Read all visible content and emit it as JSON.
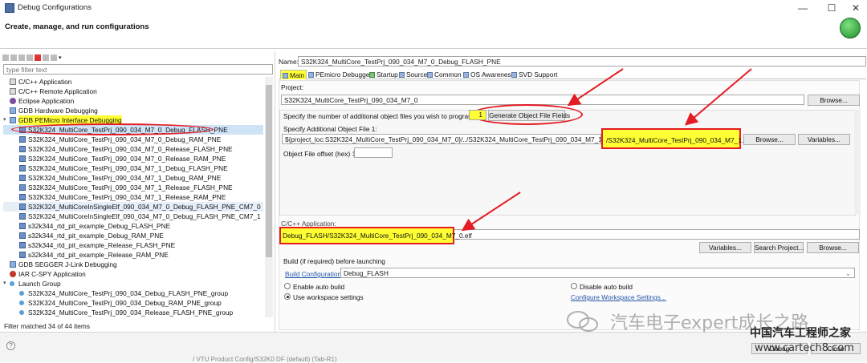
{
  "window": {
    "title": "Debug Configurations",
    "header": "Create, manage, and run configurations",
    "controls": [
      "—",
      "☐",
      "✕"
    ]
  },
  "left": {
    "filter_placeholder": "type filter text",
    "status": "Filter matched 34 of 44 items",
    "items": [
      {
        "label": "C/C++ Application",
        "level": 0,
        "icon": "c-app-icon"
      },
      {
        "label": "C/C++ Remote Application",
        "level": 0,
        "icon": "c-remote-icon"
      },
      {
        "label": "Eclipse Application",
        "level": 0,
        "icon": "eclipse-icon"
      },
      {
        "label": "GDB Hardware Debugging",
        "level": 0,
        "icon": "gdb-icon"
      },
      {
        "label": "GDB PEMicro Interface Debugging",
        "level": 0,
        "icon": "gdb-icon",
        "expanded": true,
        "highlight": true
      },
      {
        "label": "S32K324_MultiCore_TestPrj_090_034_M7_0_Debug_FLASH_PNE",
        "level": 1,
        "icon": "launch-icon",
        "selected": true
      },
      {
        "label": "S32K324_MultiCore_TestPrj_090_034_M7_0_Debug_RAM_PNE",
        "level": 1,
        "icon": "launch-icon"
      },
      {
        "label": "S32K324_MultiCore_TestPrj_090_034_M7_0_Release_FLASH_PNE",
        "level": 1,
        "icon": "launch-icon"
      },
      {
        "label": "S32K324_MultiCore_TestPrj_090_034_M7_0_Release_RAM_PNE",
        "level": 1,
        "icon": "launch-icon"
      },
      {
        "label": "S32K324_MultiCore_TestPrj_090_034_M7_1_Debug_FLASH_PNE",
        "level": 1,
        "icon": "launch-icon"
      },
      {
        "label": "S32K324_MultiCore_TestPrj_090_034_M7_1_Debug_RAM_PNE",
        "level": 1,
        "icon": "launch-icon"
      },
      {
        "label": "S32K324_MultiCore_TestPrj_090_034_M7_1_Release_FLASH_PNE",
        "level": 1,
        "icon": "launch-icon"
      },
      {
        "label": "S32K324_MultiCore_TestPrj_090_034_M7_1_Release_RAM_PNE",
        "level": 1,
        "icon": "launch-icon"
      },
      {
        "label": "S32K324_MultiCoreInSingleElf_090_034_M7_0_Debug_FLASH_PNE_CM7_0",
        "level": 1,
        "icon": "launch-icon",
        "soft": true
      },
      {
        "label": "S32K324_MultiCoreInSingleElf_090_034_M7_0_Debug_FLASH_PNE_CM7_1",
        "level": 1,
        "icon": "launch-icon"
      },
      {
        "label": "s32k344_rtd_pit_example_Debug_FLASH_PNE",
        "level": 1,
        "icon": "launch-icon"
      },
      {
        "label": "s32k344_rtd_pit_example_Debug_RAM_PNE",
        "level": 1,
        "icon": "launch-icon"
      },
      {
        "label": "s32k344_rtd_pit_example_Release_FLASH_PNE",
        "level": 1,
        "icon": "launch-icon"
      },
      {
        "label": "s32k344_rtd_pit_example_Release_RAM_PNE",
        "level": 1,
        "icon": "launch-icon"
      },
      {
        "label": "GDB SEGGER J-Link Debugging",
        "level": 0,
        "icon": "gdb-icon"
      },
      {
        "label": "IAR C-SPY Application",
        "level": 0,
        "icon": "iar-icon"
      },
      {
        "label": "Launch Group",
        "level": 0,
        "icon": "group-icon",
        "expanded": true
      },
      {
        "label": "S32K324_MultiCore_TestPrj_090_034_Debug_FLASH_PNE_group",
        "level": 1,
        "icon": "group-icon"
      },
      {
        "label": "S32K324_MultiCore_TestPrj_090_034_Debug_RAM_PNE_group",
        "level": 1,
        "icon": "group-icon"
      },
      {
        "label": "S32K324_MultiCore_TestPrj_090_034_Release_FLASH_PNE_group",
        "level": 1,
        "icon": "group-icon"
      }
    ]
  },
  "right": {
    "name_label": "Name:",
    "name_value": "S32K324_MultiCore_TestPrj_090_034_M7_0_Debug_FLASH_PNE",
    "tabs": [
      "Main",
      "PEmicro Debugger",
      "Startup",
      "Source",
      "Common",
      "OS Awareness",
      "SVD Support"
    ],
    "project_label": "Project:",
    "project_value": "S32K324_MultiCore_TestPrj_090_034_M7_0",
    "browse": "Browse...",
    "additional_count_label": "Specify the number of additional object files you wish to program:",
    "additional_count": "1",
    "generate_button": "Generate Object File Fields",
    "additional_file_label": "Specify Additional Object File 1:",
    "additional_file_prefix": "${project_loc:S32K324_MultiCore_TestPrj_090_034_M7_0}/../S32K324_MultiCore_TestPrj_090_034_M7_1/Debug_FLASH",
    "additional_file_highlight": "/S32K324_MultiCore_TestPrj_090_034_M7_1.elf",
    "variables": "Variables...",
    "offset_label": "Object File offset (hex) 1:",
    "offset_value": "",
    "app_label": "C/C++ Application:",
    "app_value": "Debug_FLASH/S32K324_MultiCore_TestPrj_090_034_M7_0.elf",
    "search_project": "Search Project...",
    "build_label": "Build (if required) before launching",
    "build_config_label": "Build Configuration:",
    "build_config_value": "Debug_FLASH",
    "enable_auto": "Enable auto build",
    "disable_auto": "Disable auto build",
    "workspace_settings": "Use workspace settings",
    "configure_workspace": "Configure Workspace Settings..."
  },
  "watermark": {
    "text": "汽车电子expert成长之路",
    "brand": "中国汽车工程师之家",
    "url": "www.cartech8.com"
  },
  "footer": {
    "help": "?",
    "button_left": "Debug",
    "button_right": "Close",
    "bottom_fragment": "/ VTU Product Config/S32K0 DF (default) (Tab-R1)"
  },
  "colors": {
    "highlight": "#ffff33",
    "annotation_red": "#e51c23",
    "link": "#2558a8"
  }
}
